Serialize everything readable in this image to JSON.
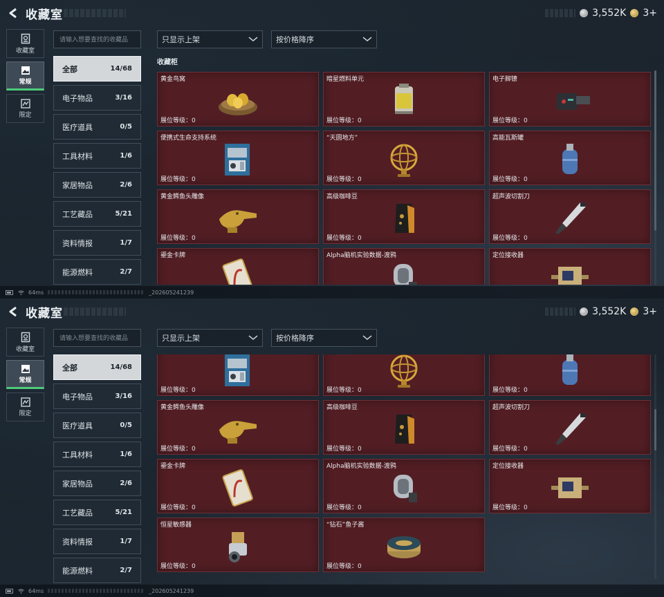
{
  "header": {
    "title": "收藏室",
    "silver": "3,552K",
    "gold": "3+"
  },
  "left_nav": [
    {
      "label": "收藏室",
      "icon": "collection-icon"
    },
    {
      "label": "常规",
      "icon": "image-icon",
      "active": true
    },
    {
      "label": "限定",
      "icon": "limited-icon"
    }
  ],
  "search": {
    "placeholder": "请输入想要查找的收藏品"
  },
  "filters": {
    "shelf": "只显示上架",
    "sort": "按价格降序"
  },
  "categories": [
    {
      "name": "全部",
      "count": "14/68",
      "active": true
    },
    {
      "name": "电子物品",
      "count": "3/16"
    },
    {
      "name": "医疗道具",
      "count": "0/5"
    },
    {
      "name": "工具材料",
      "count": "1/6"
    },
    {
      "name": "家居物品",
      "count": "2/6"
    },
    {
      "name": "工艺藏品",
      "count": "5/21"
    },
    {
      "name": "资料情报",
      "count": "1/7"
    },
    {
      "name": "能源燃料",
      "count": "2/7"
    }
  ],
  "cabinet_title": "收藏柜",
  "level_label": "展位等级：0",
  "items": [
    {
      "name": "黄金鸟窝",
      "icon": "golden-nest-icon"
    },
    {
      "name": "暗星燃料单元",
      "icon": "fuel-cell-icon"
    },
    {
      "name": "电子脚镣",
      "icon": "ankle-monitor-icon"
    },
    {
      "name": "便携式生命支持系统",
      "icon": "life-support-icon"
    },
    {
      "name": "“天圆地方”",
      "icon": "armillary-sphere-icon"
    },
    {
      "name": "高能瓦斯罐",
      "icon": "gas-tank-icon"
    },
    {
      "name": "黄金鳄鱼头雕像",
      "icon": "croc-statue-icon"
    },
    {
      "name": "高级咖啡豆",
      "icon": "coffee-bag-icon"
    },
    {
      "name": "超声波切割刀",
      "icon": "ultrasonic-cutter-icon"
    },
    {
      "name": "鎏金卡牌",
      "icon": "gilded-card-icon"
    },
    {
      "name": "Alpha脑机实验数据-渡鸦",
      "icon": "data-drive-icon"
    },
    {
      "name": "定位接收器",
      "icon": "receiver-icon"
    },
    {
      "name": "恒星敏感器",
      "icon": "star-sensor-icon"
    },
    {
      "name": "“钻石”鱼子酱",
      "icon": "caviar-tin-icon"
    }
  ],
  "status": {
    "ping": "64ms",
    "build": "_202605241239"
  },
  "colors": {
    "card_bg": "#521e24",
    "active_tab": "#4ecb7a",
    "gold": "#c9a44a"
  }
}
